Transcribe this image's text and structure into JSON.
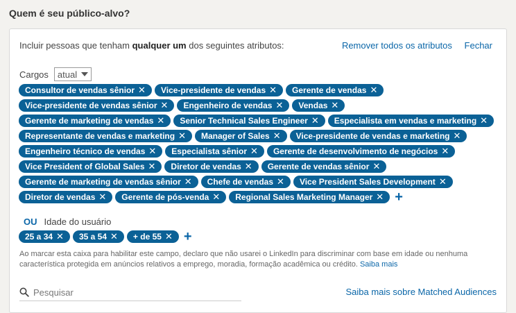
{
  "heading": "Quem é seu público-alvo?",
  "intro": {
    "prefix": "Incluir pessoas que tenham ",
    "bold": "qualquer um",
    "suffix": " dos seguintes atributos:"
  },
  "top_links": {
    "remove_all": "Remover todos os atributos",
    "close": "Fechar"
  },
  "cargos": {
    "label": "Cargos",
    "select_value": "atual",
    "chips": [
      "Consultor de vendas sênior",
      "Vice-presidente de vendas",
      "Gerente de vendas",
      "Vice-presidente de vendas sênior",
      "Engenheiro de vendas",
      "Vendas",
      "Gerente de marketing de vendas",
      "Senior Technical Sales Engineer",
      "Especialista em vendas e marketing",
      "Representante de vendas e marketing",
      "Manager of Sales",
      "Vice-presidente de vendas e marketing",
      "Engenheiro técnico de vendas",
      "Especialista sênior",
      "Gerente de desenvolvimento de negócios",
      "Vice President of Global Sales",
      "Diretor de vendas",
      "Gerente de vendas sênior",
      "Gerente de marketing de vendas sênior",
      "Chefe de vendas",
      "Vice President Sales Development",
      "Diretor de vendas",
      "Gerente de pós-venda",
      "Regional Sales Marketing Manager"
    ]
  },
  "or_label": "OU",
  "age": {
    "label": "Idade do usuário",
    "chips": [
      "25 a 34",
      "35 a 54",
      "+ de 55"
    ]
  },
  "disclaimer": {
    "text": "Ao marcar esta caixa para habilitar este campo, declaro que não usarei o LinkedIn para discriminar com base em idade ou nenhuma característica protegida em anúncios relativos a emprego, moradia, formação acadêmica ou crédito. ",
    "link": "Saiba mais"
  },
  "search": {
    "placeholder": "Pesquisar"
  },
  "matched_link": "Saiba mais sobre Matched Audiences",
  "remove_glyph": "✕",
  "add_glyph": "+"
}
